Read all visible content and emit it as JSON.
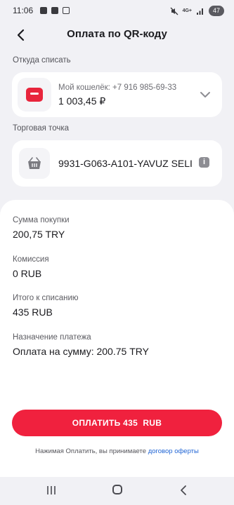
{
  "status_bar": {
    "time": "11:06",
    "network": "4G+",
    "battery": "47"
  },
  "header": {
    "title": "Оплата по QR-коду"
  },
  "source": {
    "label": "Откуда списать",
    "wallet_name": "Мой кошелёк: +7 916 985-69-33",
    "balance": "1 003,45 ₽"
  },
  "merchant": {
    "label": "Торговая точка",
    "name": "9931-G063-A101-YAVUZ SELI"
  },
  "details": {
    "amount_label": "Сумма покупки",
    "amount_value": "200,75 TRY",
    "fee_label": "Комиссия",
    "fee_value": "0 RUB",
    "total_label": "Итого к списанию",
    "total_value": "435 RUB",
    "purpose_label": "Назначение платежа",
    "purpose_value": "Оплата на сумму: 200.75 TRY"
  },
  "pay_button": {
    "label": "ОПЛАТИТЬ 435  RUB"
  },
  "terms": {
    "text": "Нажимая Оплатить, вы принимаете",
    "link": "договор оферты"
  },
  "colors": {
    "accent": "#f0213e",
    "link": "#1f64d4",
    "background": "#f1f1f5"
  },
  "icons": [
    "back-arrow-icon",
    "wallet-icon",
    "chevron-down-icon",
    "basket-icon",
    "info-icon",
    "recents-icon",
    "home-icon",
    "nav-back-icon"
  ]
}
